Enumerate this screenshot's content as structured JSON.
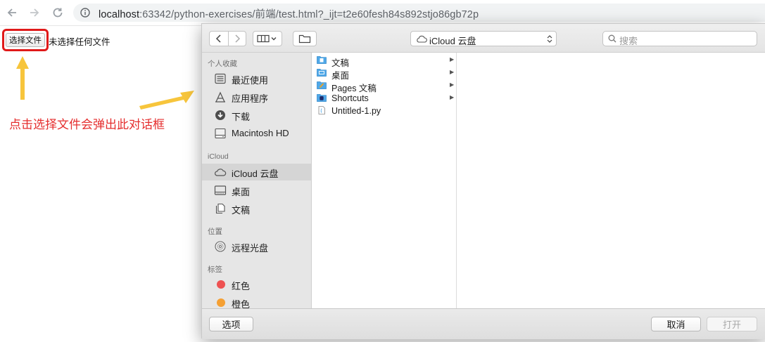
{
  "browser": {
    "url_host": "localhost",
    "url_rest": ":63342/python-exercises/前端/test.html?_ijt=t2e60fesh84s892stjo86gb72p"
  },
  "page": {
    "file_button_label": "选择文件",
    "no_file_text": "未选择任何文件",
    "annotation": "点击选择文件会弹出此对话框"
  },
  "dialog": {
    "location": "iCloud 云盘",
    "search_placeholder": "搜索",
    "sidebar": {
      "favorites_header": "个人收藏",
      "favorites": [
        "最近使用",
        "应用程序",
        "下载",
        "Macintosh HD"
      ],
      "icloud_header": "iCloud",
      "icloud": [
        "iCloud 云盘",
        "桌面",
        "文稿"
      ],
      "locations_header": "位置",
      "locations": [
        "远程光盘"
      ],
      "tags_header": "标签",
      "tags": [
        {
          "label": "红色",
          "color": "#ee5252"
        },
        {
          "label": "橙色",
          "color": "#f5a033"
        }
      ]
    },
    "files": [
      {
        "name": "文稿",
        "icon": "folder-docs-icon",
        "folder": true
      },
      {
        "name": "桌面",
        "icon": "folder-desktop-icon",
        "folder": true
      },
      {
        "name": "Pages 文稿",
        "icon": "folder-pages-icon",
        "folder": true
      },
      {
        "name": "Shortcuts",
        "icon": "folder-shortcuts-icon",
        "folder": true
      },
      {
        "name": "Untitled-1.py",
        "icon": "file-icon",
        "folder": false
      }
    ],
    "options_label": "选项",
    "cancel_label": "取消",
    "open_label": "打开"
  },
  "colors": {
    "highlight_red": "#e01a1a",
    "annotation_red": "#e52e2e",
    "arrow_yellow": "#f7c53c",
    "folder_blue": "#4fa8e8"
  }
}
